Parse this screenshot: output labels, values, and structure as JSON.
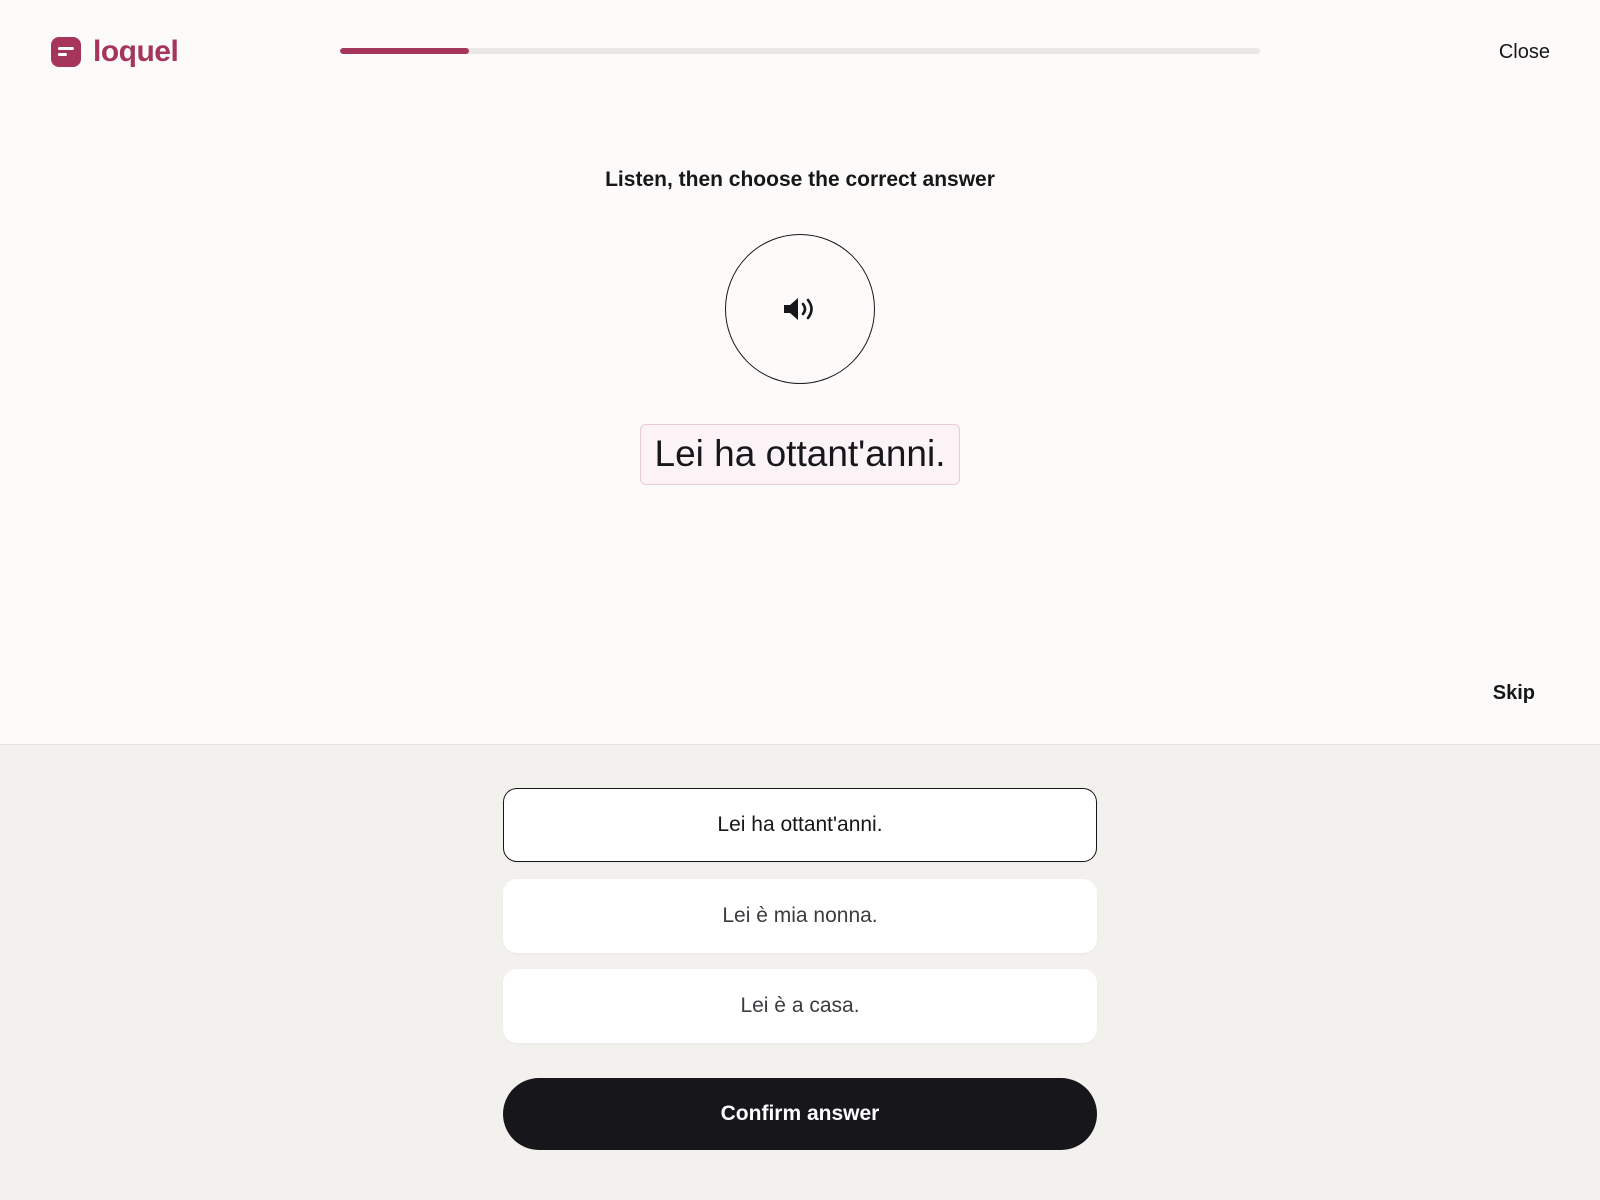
{
  "app": {
    "logo_text": "loquel",
    "brand_color": "#a5355a",
    "close_label": "Close",
    "progress": 0.14
  },
  "exercise": {
    "instruction": "Listen, then choose the correct answer",
    "audio_icon": "speaker-icon",
    "phrase": "Lei ha ottant'anni.",
    "skip_label": "Skip"
  },
  "options": [
    {
      "label": "Lei ha ottant'anni.",
      "selected": true
    },
    {
      "label": "Lei è mia nonna.",
      "selected": false
    },
    {
      "label": "Lei è a casa.",
      "selected": false
    }
  ],
  "confirm_label": "Confirm answer"
}
